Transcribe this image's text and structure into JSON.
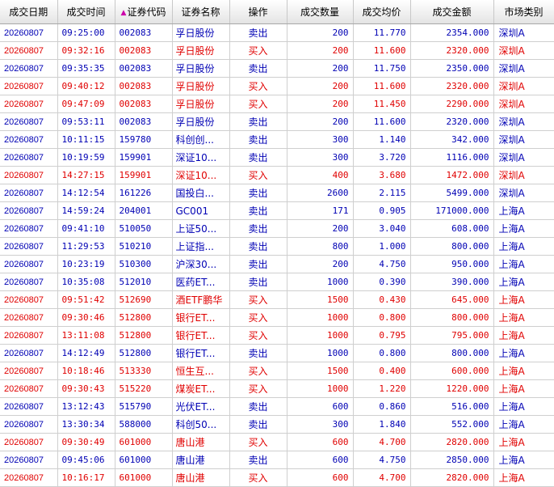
{
  "columns": {
    "date": "成交日期",
    "time": "成交时间",
    "code": "证券代码",
    "name": "证券名称",
    "action": "操作",
    "qty": "成交数量",
    "price": "成交均价",
    "amount": "成交金额",
    "market": "市场类别",
    "sort_icon": "triangle-up-icon"
  },
  "colors": {
    "buy": "#e00000",
    "sell": "#0000b4"
  },
  "rows": [
    {
      "date": "20260807",
      "time": "09:25:00",
      "code": "002083",
      "name": "孚日股份",
      "action": "卖出",
      "qty": "200",
      "price": "11.770",
      "amount": "2354.000",
      "market": "深圳A",
      "side": "sell"
    },
    {
      "date": "20260807",
      "time": "09:32:16",
      "code": "002083",
      "name": "孚日股份",
      "action": "买入",
      "qty": "200",
      "price": "11.600",
      "amount": "2320.000",
      "market": "深圳A",
      "side": "buy"
    },
    {
      "date": "20260807",
      "time": "09:35:35",
      "code": "002083",
      "name": "孚日股份",
      "action": "卖出",
      "qty": "200",
      "price": "11.750",
      "amount": "2350.000",
      "market": "深圳A",
      "side": "sell"
    },
    {
      "date": "20260807",
      "time": "09:40:12",
      "code": "002083",
      "name": "孚日股份",
      "action": "买入",
      "qty": "200",
      "price": "11.600",
      "amount": "2320.000",
      "market": "深圳A",
      "side": "buy"
    },
    {
      "date": "20260807",
      "time": "09:47:09",
      "code": "002083",
      "name": "孚日股份",
      "action": "买入",
      "qty": "200",
      "price": "11.450",
      "amount": "2290.000",
      "market": "深圳A",
      "side": "buy"
    },
    {
      "date": "20260807",
      "time": "09:53:11",
      "code": "002083",
      "name": "孚日股份",
      "action": "卖出",
      "qty": "200",
      "price": "11.600",
      "amount": "2320.000",
      "market": "深圳A",
      "side": "sell"
    },
    {
      "date": "20260807",
      "time": "10:11:15",
      "code": "159780",
      "name": "科创创...",
      "action": "卖出",
      "qty": "300",
      "price": "1.140",
      "amount": "342.000",
      "market": "深圳A",
      "side": "sell"
    },
    {
      "date": "20260807",
      "time": "10:19:59",
      "code": "159901",
      "name": "深证10...",
      "action": "卖出",
      "qty": "300",
      "price": "3.720",
      "amount": "1116.000",
      "market": "深圳A",
      "side": "sell"
    },
    {
      "date": "20260807",
      "time": "14:27:15",
      "code": "159901",
      "name": "深证10...",
      "action": "买入",
      "qty": "400",
      "price": "3.680",
      "amount": "1472.000",
      "market": "深圳A",
      "side": "buy"
    },
    {
      "date": "20260807",
      "time": "14:12:54",
      "code": "161226",
      "name": "国投白...",
      "action": "卖出",
      "qty": "2600",
      "price": "2.115",
      "amount": "5499.000",
      "market": "深圳A",
      "side": "sell"
    },
    {
      "date": "20260807",
      "time": "14:59:24",
      "code": "204001",
      "name": "GC001",
      "action": "卖出",
      "qty": "171",
      "price": "0.905",
      "amount": "171000.000",
      "market": "上海A",
      "side": "sell"
    },
    {
      "date": "20260807",
      "time": "09:41:10",
      "code": "510050",
      "name": "上证50...",
      "action": "卖出",
      "qty": "200",
      "price": "3.040",
      "amount": "608.000",
      "market": "上海A",
      "side": "sell"
    },
    {
      "date": "20260807",
      "time": "11:29:53",
      "code": "510210",
      "name": "上证指...",
      "action": "卖出",
      "qty": "800",
      "price": "1.000",
      "amount": "800.000",
      "market": "上海A",
      "side": "sell"
    },
    {
      "date": "20260807",
      "time": "10:23:19",
      "code": "510300",
      "name": "沪深30...",
      "action": "卖出",
      "qty": "200",
      "price": "4.750",
      "amount": "950.000",
      "market": "上海A",
      "side": "sell"
    },
    {
      "date": "20260807",
      "time": "10:35:08",
      "code": "512010",
      "name": "医药ET...",
      "action": "卖出",
      "qty": "1000",
      "price": "0.390",
      "amount": "390.000",
      "market": "上海A",
      "side": "sell"
    },
    {
      "date": "20260807",
      "time": "09:51:42",
      "code": "512690",
      "name": "酒ETF鹏华",
      "action": "买入",
      "qty": "1500",
      "price": "0.430",
      "amount": "645.000",
      "market": "上海A",
      "side": "buy"
    },
    {
      "date": "20260807",
      "time": "09:30:46",
      "code": "512800",
      "name": "银行ET...",
      "action": "买入",
      "qty": "1000",
      "price": "0.800",
      "amount": "800.000",
      "market": "上海A",
      "side": "buy"
    },
    {
      "date": "20260807",
      "time": "13:11:08",
      "code": "512800",
      "name": "银行ET...",
      "action": "买入",
      "qty": "1000",
      "price": "0.795",
      "amount": "795.000",
      "market": "上海A",
      "side": "buy"
    },
    {
      "date": "20260807",
      "time": "14:12:49",
      "code": "512800",
      "name": "银行ET...",
      "action": "卖出",
      "qty": "1000",
      "price": "0.800",
      "amount": "800.000",
      "market": "上海A",
      "side": "sell"
    },
    {
      "date": "20260807",
      "time": "10:18:46",
      "code": "513330",
      "name": "恒生互...",
      "action": "买入",
      "qty": "1500",
      "price": "0.400",
      "amount": "600.000",
      "market": "上海A",
      "side": "buy"
    },
    {
      "date": "20260807",
      "time": "09:30:43",
      "code": "515220",
      "name": "煤炭ET...",
      "action": "买入",
      "qty": "1000",
      "price": "1.220",
      "amount": "1220.000",
      "market": "上海A",
      "side": "buy"
    },
    {
      "date": "20260807",
      "time": "13:12:43",
      "code": "515790",
      "name": "光伏ET...",
      "action": "卖出",
      "qty": "600",
      "price": "0.860",
      "amount": "516.000",
      "market": "上海A",
      "side": "sell"
    },
    {
      "date": "20260807",
      "time": "13:30:34",
      "code": "588000",
      "name": "科创50...",
      "action": "卖出",
      "qty": "300",
      "price": "1.840",
      "amount": "552.000",
      "market": "上海A",
      "side": "sell"
    },
    {
      "date": "20260807",
      "time": "09:30:49",
      "code": "601000",
      "name": "唐山港",
      "action": "买入",
      "qty": "600",
      "price": "4.700",
      "amount": "2820.000",
      "market": "上海A",
      "side": "buy"
    },
    {
      "date": "20260807",
      "time": "09:45:06",
      "code": "601000",
      "name": "唐山港",
      "action": "卖出",
      "qty": "600",
      "price": "4.750",
      "amount": "2850.000",
      "market": "上海A",
      "side": "sell"
    },
    {
      "date": "20260807",
      "time": "10:16:17",
      "code": "601000",
      "name": "唐山港",
      "action": "买入",
      "qty": "600",
      "price": "4.700",
      "amount": "2820.000",
      "market": "上海A",
      "side": "buy"
    }
  ]
}
